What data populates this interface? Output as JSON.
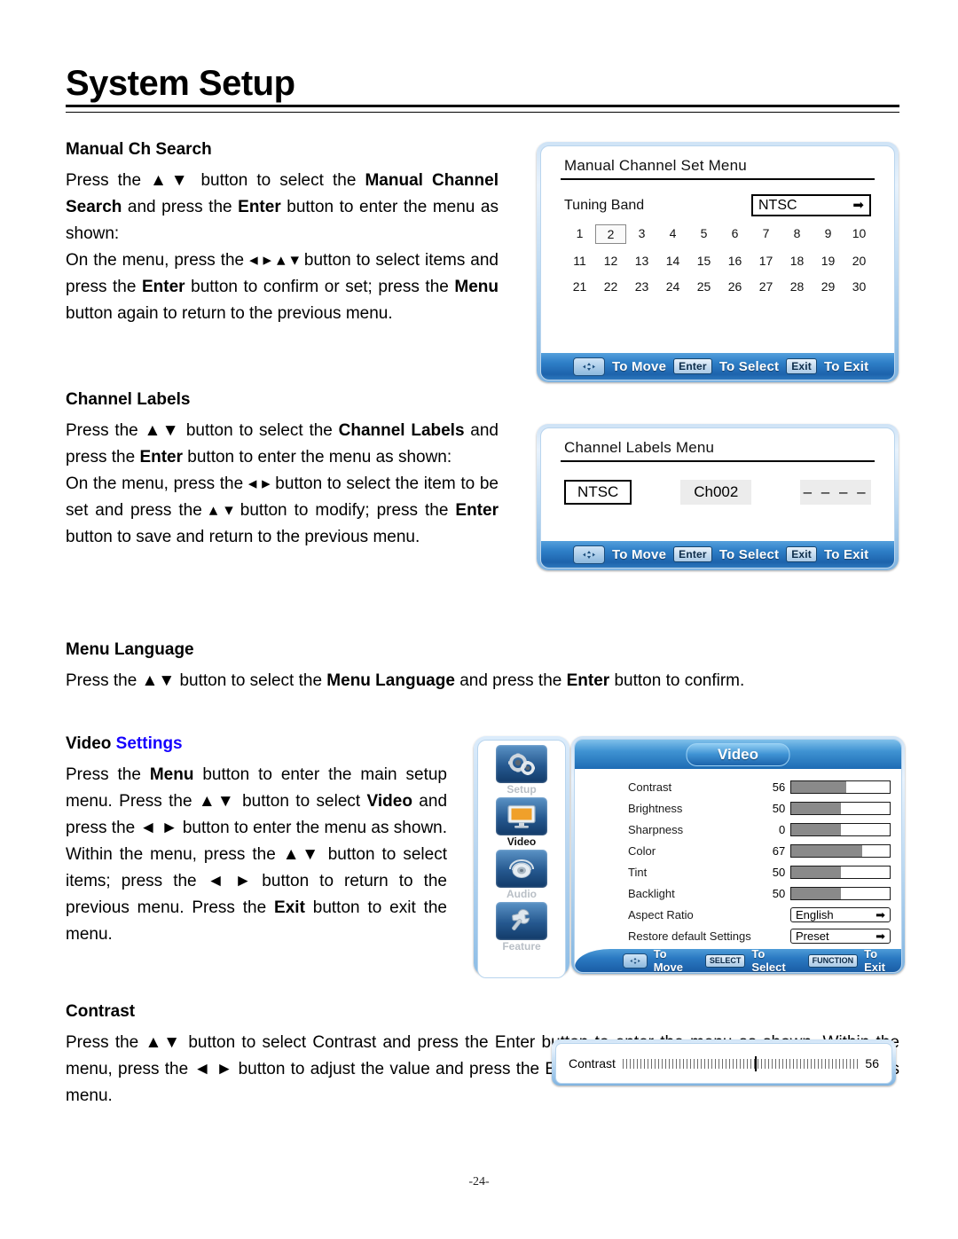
{
  "page": {
    "title": "System Setup",
    "page_number": "-24-"
  },
  "sections": {
    "manual_ch_search": {
      "heading": "Manual Ch Search",
      "para1_pre": "Press the ",
      "para1_arrows": "▲▼",
      "para1_mid": " button to select the ",
      "para1_b1": "Manual Channel Search",
      "para1_mid2": " and press the ",
      "para1_b2": "Enter",
      "para1_end": " button to enter the menu as shown:",
      "para2_pre": "On the menu, press the ",
      "para2_arrows": "◂ ▸ ▴ ▾",
      "para2_mid": " button to select items and press the ",
      "para2_b1": "Enter",
      "para2_mid2": " button to confirm or set; press the ",
      "para2_b2": "Menu",
      "para2_end": " button again to return to the previous menu."
    },
    "channel_labels": {
      "heading": "Channel Labels",
      "para1_pre": "Press the ",
      "para1_arrows": "▲▼",
      "para1_mid": " button to select the ",
      "para1_b1": "Channel Labels",
      "para1_mid2": " and press the ",
      "para1_b2": "Enter",
      "para1_end": " button to enter the menu as shown:",
      "para2_pre": "On the menu, press the ",
      "para2_arrows1": "◂ ▸",
      "para2_mid": " button to select the item to be set and press the ",
      "para2_arrows2": "▴ ▾",
      "para2_mid2": " button to modify; press the ",
      "para2_b1": "Enter",
      "para2_end": " button to save and return to the previous menu."
    },
    "menu_language": {
      "heading": "Menu Language",
      "para_pre": "Press the ",
      "para_arrows": "▲▼",
      "para_mid": " button to select the ",
      "para_b1": "Menu Language",
      "para_mid2": " and press the ",
      "para_b2": "Enter",
      "para_end": " button to confirm."
    },
    "video_settings": {
      "heading_plain": "Video ",
      "heading_blue": "Settings",
      "para_pre": "Press the ",
      "para_b1": "Menu",
      "para_s1": " button to enter the main setup menu. Press the ",
      "para_arrows1": "▲▼",
      "para_s2": " button to select ",
      "para_b2": "Video",
      "para_s3": " and press the ",
      "para_arrows2": "◄ ►",
      "para_s4": " button to enter the menu as shown. Within the menu, press the ",
      "para_arrows3": "▲▼",
      "para_s5": " button to select items; press the ",
      "para_arrows4": "◄ ►",
      "para_s6": " button to return to the previous menu. Press the ",
      "para_b3": "Exit",
      "para_s7": " button to exit the menu."
    },
    "contrast": {
      "heading": "Contrast",
      "para_pre": "Press the ",
      "para_arrows1": "▲▼",
      "para_mid": " button to select Contrast and press the Enter button to enter the menu as shown. Within the menu, press the ",
      "para_arrows2": "◄ ►",
      "para_end": " button to adjust the value and press the Enter button to save and return to the previous menu."
    }
  },
  "osd_manual_channel": {
    "title": "Manual Channel Set Menu",
    "tuning_band_label": "Tuning Band",
    "tuning_band_value": "NTSC",
    "arrow_glyph": "➡",
    "channels": [
      "1",
      "2",
      "3",
      "4",
      "5",
      "6",
      "7",
      "8",
      "9",
      "10",
      "11",
      "12",
      "13",
      "14",
      "15",
      "16",
      "17",
      "18",
      "19",
      "20",
      "21",
      "22",
      "23",
      "24",
      "25",
      "26",
      "27",
      "28",
      "29",
      "30"
    ],
    "selected_channel": "2",
    "footer": {
      "dpad_label": "To Move",
      "enter_key": "Enter",
      "enter_label": "To Select",
      "exit_key": "Exit",
      "exit_label": "To Exit"
    }
  },
  "osd_channel_labels": {
    "title": "Channel Labels Menu",
    "band": "NTSC",
    "channel": "Ch002",
    "label_value": "– – – –",
    "footer": {
      "dpad_label": "To Move",
      "enter_key": "Enter",
      "enter_label": "To Select",
      "exit_key": "Exit",
      "exit_label": "To Exit"
    }
  },
  "osd_video": {
    "header_title": "Video",
    "sidebar": [
      {
        "icon": "gears-icon",
        "label": "Setup",
        "active": false
      },
      {
        "icon": "monitor-icon",
        "label": "Video",
        "active": true
      },
      {
        "icon": "speaker-icon",
        "label": "Audio",
        "active": false
      },
      {
        "icon": "wrench-icon",
        "label": "Feature",
        "active": false
      }
    ],
    "rows": [
      {
        "label": "Contrast",
        "value": "56",
        "fill_pct": 56
      },
      {
        "label": "Brightness",
        "value": "50",
        "fill_pct": 50
      },
      {
        "label": "Sharpness",
        "value": "0",
        "fill_pct": 50
      },
      {
        "label": "Color",
        "value": "67",
        "fill_pct": 72
      },
      {
        "label": "Tint",
        "value": "50",
        "fill_pct": 50
      },
      {
        "label": "Backlight",
        "value": "50",
        "fill_pct": 50
      }
    ],
    "selects": [
      {
        "label": "Aspect Ratio",
        "value": "English",
        "arrow": "➡"
      },
      {
        "label": "Restore default Settings",
        "value": "Preset",
        "arrow": "➡"
      }
    ],
    "footer": {
      "dpad_label": "To Move",
      "select_key": "SELECT",
      "select_label": "To Select",
      "function_key": "FUNCTION",
      "function_label": "To Exit"
    }
  },
  "osd_contrast": {
    "label": "Contrast",
    "value": "56",
    "knob_pct": 56
  },
  "colors": {
    "accent_blue": "#1d6bb4",
    "link_blue": "#1400ff",
    "bar_fill": "#8a8a8a"
  }
}
